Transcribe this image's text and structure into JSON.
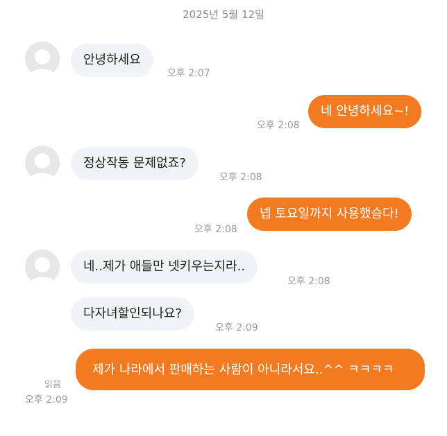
{
  "chat": {
    "date": "2025년 5월 12일",
    "messages": [
      {
        "sender": "other",
        "text": "안녕하세요",
        "time": "오후 2:07"
      },
      {
        "sender": "me",
        "text": "네 안녕하세요~!",
        "time": "오후 2:08"
      },
      {
        "sender": "other",
        "text": "정상작동 문제없죠?",
        "time": "오후 2:08"
      },
      {
        "sender": "me",
        "text": "넵 토요일까지 사용했슴다!",
        "time": "오후 2:08"
      },
      {
        "sender": "other",
        "text": "네..제가 애들만 넷키우는지라..",
        "time": "오후 2:08"
      },
      {
        "sender": "other",
        "text": "다자녀할인되나요?",
        "time": "오후 2:09"
      },
      {
        "sender": "me",
        "text": "제가 나라에서 판매하는 사람이 아니라서요..^^ ㅋㅋㅋㅋ",
        "time": "오후 2:09",
        "status": "읽음"
      }
    ]
  },
  "colors": {
    "outgoing_bubble": "#f27a21",
    "incoming_bubble": "#f2f3f6",
    "timestamp": "#9a9a9a"
  },
  "icons": {
    "avatar": "default-profile-icon"
  }
}
